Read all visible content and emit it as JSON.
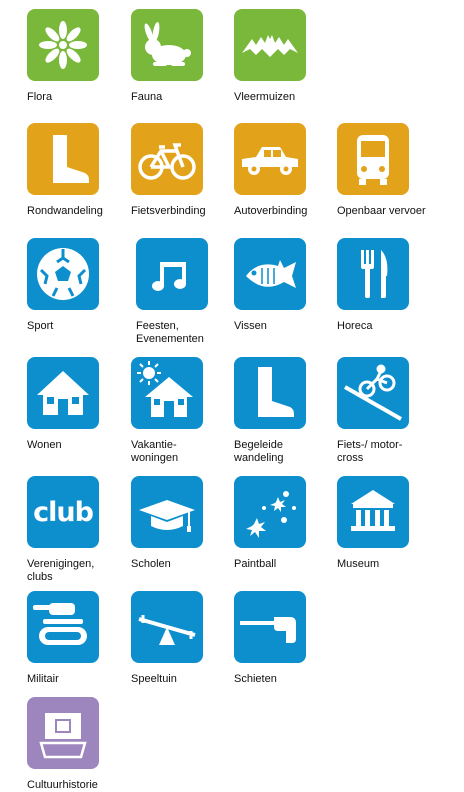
{
  "colors": {
    "green": "#79b83a",
    "orange": "#e2a21a",
    "blue": "#0d8fce",
    "purple": "#9c86bd"
  },
  "icons": [
    {
      "label": "Flora",
      "icon": "flower-icon",
      "color": "green"
    },
    {
      "label": "Fauna",
      "icon": "rabbit-icon",
      "color": "green"
    },
    {
      "label": "Vleermuizen",
      "icon": "bat-icon",
      "color": "green"
    },
    {
      "label": "Rondwandeling",
      "icon": "boot-icon",
      "color": "orange"
    },
    {
      "label": "Fietsverbinding",
      "icon": "bicycle-icon",
      "color": "orange"
    },
    {
      "label": "Autoverbinding",
      "icon": "car-icon",
      "color": "orange"
    },
    {
      "label": "Openbaar vervoer",
      "icon": "bus-icon",
      "color": "orange"
    },
    {
      "label": "Sport",
      "icon": "soccer-ball-icon",
      "color": "blue"
    },
    {
      "label": "Feesten,\nEvenementen",
      "icon": "music-note-icon",
      "color": "blue"
    },
    {
      "label": "Vissen",
      "icon": "fish-icon",
      "color": "blue"
    },
    {
      "label": "Horeca",
      "icon": "fork-knife-icon",
      "color": "blue"
    },
    {
      "label": "Wonen",
      "icon": "house-icon",
      "color": "blue"
    },
    {
      "label": "Vakantie-\nwoningen",
      "icon": "house-sun-icon",
      "color": "blue"
    },
    {
      "label": "Begeleide\nwandeling",
      "icon": "boot-icon",
      "color": "blue"
    },
    {
      "label": "Fiets-/ motor-\ncross",
      "icon": "motocross-icon",
      "color": "blue"
    },
    {
      "label": "Verenigingen,\nclubs",
      "icon": "club-text-icon",
      "color": "blue",
      "text": "club"
    },
    {
      "label": "Scholen",
      "icon": "graduation-cap-icon",
      "color": "blue"
    },
    {
      "label": "Paintball",
      "icon": "paint-splat-icon",
      "color": "blue"
    },
    {
      "label": "Museum",
      "icon": "museum-icon",
      "color": "blue"
    },
    {
      "label": "Militair",
      "icon": "tank-icon",
      "color": "blue"
    },
    {
      "label": "Speeltuin",
      "icon": "seesaw-icon",
      "color": "blue"
    },
    {
      "label": "Schieten",
      "icon": "gun-icon",
      "color": "blue"
    },
    {
      "label": "Cultuurhistorie",
      "icon": "monument-icon",
      "color": "purple"
    }
  ]
}
